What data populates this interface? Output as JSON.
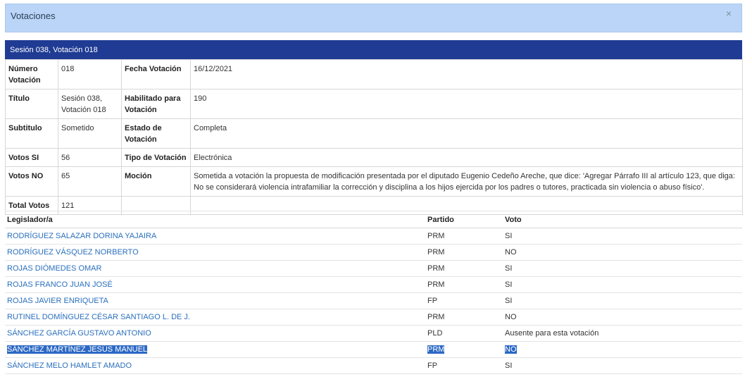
{
  "modal": {
    "title": "Votaciones",
    "close_icon": "×"
  },
  "session": {
    "header": "Sesión 038, Votación 018"
  },
  "info": {
    "numero_label": "Número Votación",
    "numero_value": "018",
    "fecha_label": "Fecha Votación",
    "fecha_value": "16/12/2021",
    "titulo_label": "Título",
    "titulo_value": "Sesión 038, Votación 018",
    "habilitado_label": "Habilitado para Votación",
    "habilitado_value": "190",
    "subtitulo_label": "Subtitulo",
    "subtitulo_value": "Sometido",
    "estado_label": "Estado de Votación",
    "estado_value": "Completa",
    "si_label": "Votos SI",
    "si_value": "56",
    "tipo_label": "Tipo de Votación",
    "tipo_value": "Electrónica",
    "no_label": "Votos NO",
    "no_value": "65",
    "mocion_label": "Moción",
    "mocion_value": "Sometida a votación la propuesta de modificación presentada por el diputado Eugenio Cedeño Areche, que dice: 'Agregar Párrafo III al artículo 123, que diga: No se considerará violencia intrafamiliar la corrección y disciplina a los hijos ejercida por los padres o tutores, practicada sin violencia o abuso físico'.",
    "total_label": "Total Votos",
    "total_value": "121"
  },
  "table": {
    "headers": {
      "legislador": "Legislador/a",
      "partido": "Partido",
      "voto": "Voto"
    },
    "rows": [
      {
        "name": "RODRÍGUEZ SALAZAR DORINA YAJAIRA",
        "party": "PRM",
        "vote": "SI"
      },
      {
        "name": "RODRÍGUEZ VÁSQUEZ NORBERTO",
        "party": "PRM",
        "vote": "NO"
      },
      {
        "name": "ROJAS DIÓMEDES OMAR",
        "party": "PRM",
        "vote": "SI"
      },
      {
        "name": "ROJAS FRANCO JUAN JOSÉ",
        "party": "PRM",
        "vote": "SI"
      },
      {
        "name": "ROJAS JAVIER ENRIQUETA",
        "party": "FP",
        "vote": "SI"
      },
      {
        "name": "RUTINEL DOMÍNGUEZ CÉSAR SANTIAGO L. DE J.",
        "party": "PRM",
        "vote": "NO"
      },
      {
        "name": "SÁNCHEZ GARCÍA GUSTAVO ANTONIO",
        "party": "PLD",
        "vote": "Ausente para esta votación"
      },
      {
        "name": "SÁNCHEZ MARTÍNEZ JESÚS MANUEL",
        "party": "PRM",
        "vote": "NO"
      },
      {
        "name": "SÁNCHEZ MELO HAMLET AMADO",
        "party": "FP",
        "vote": "SI"
      }
    ]
  }
}
